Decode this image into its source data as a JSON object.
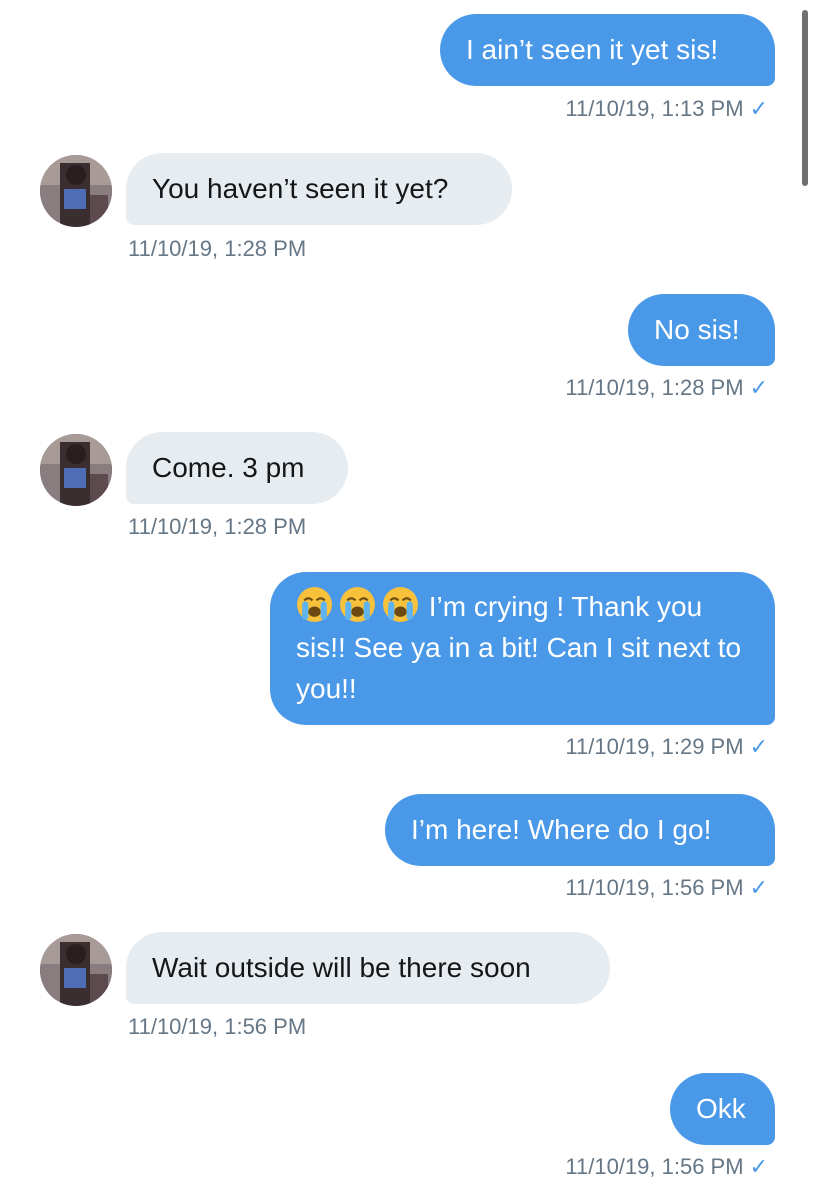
{
  "thread": {
    "messages": [
      {
        "direction": "sent",
        "text": "I ain’t seen it yet sis!",
        "timestamp": "11/10/19, 1:13 PM"
      },
      {
        "direction": "received",
        "text": "You haven’t seen it yet?",
        "timestamp": "11/10/19, 1:28 PM"
      },
      {
        "direction": "sent",
        "text": "No sis!",
        "timestamp": "11/10/19, 1:28 PM"
      },
      {
        "direction": "received",
        "text": "Come. 3 pm",
        "timestamp": "11/10/19, 1:28 PM"
      },
      {
        "direction": "sent",
        "emoji": "loudly-crying-face x3",
        "text": "I’m crying ! Thank you sis!! See ya in a bit! Can I sit next to you!!",
        "timestamp": "11/10/19, 1:29 PM"
      },
      {
        "direction": "sent",
        "text": "I’m here! Where do I go!",
        "timestamp": "11/10/19, 1:56 PM"
      },
      {
        "direction": "received",
        "text": "Wait outside will be there soon",
        "timestamp": "11/10/19, 1:56 PM"
      },
      {
        "direction": "sent",
        "text": "Okk",
        "timestamp": "11/10/19, 1:56 PM"
      }
    ],
    "read_receipt_icon": "checkmark-icon"
  },
  "colors": {
    "sent_bubble": "#4a99e9",
    "received_bubble": "#e6ecf0",
    "timestamp_text": "#657786",
    "checkmark": "#4a99e9"
  }
}
